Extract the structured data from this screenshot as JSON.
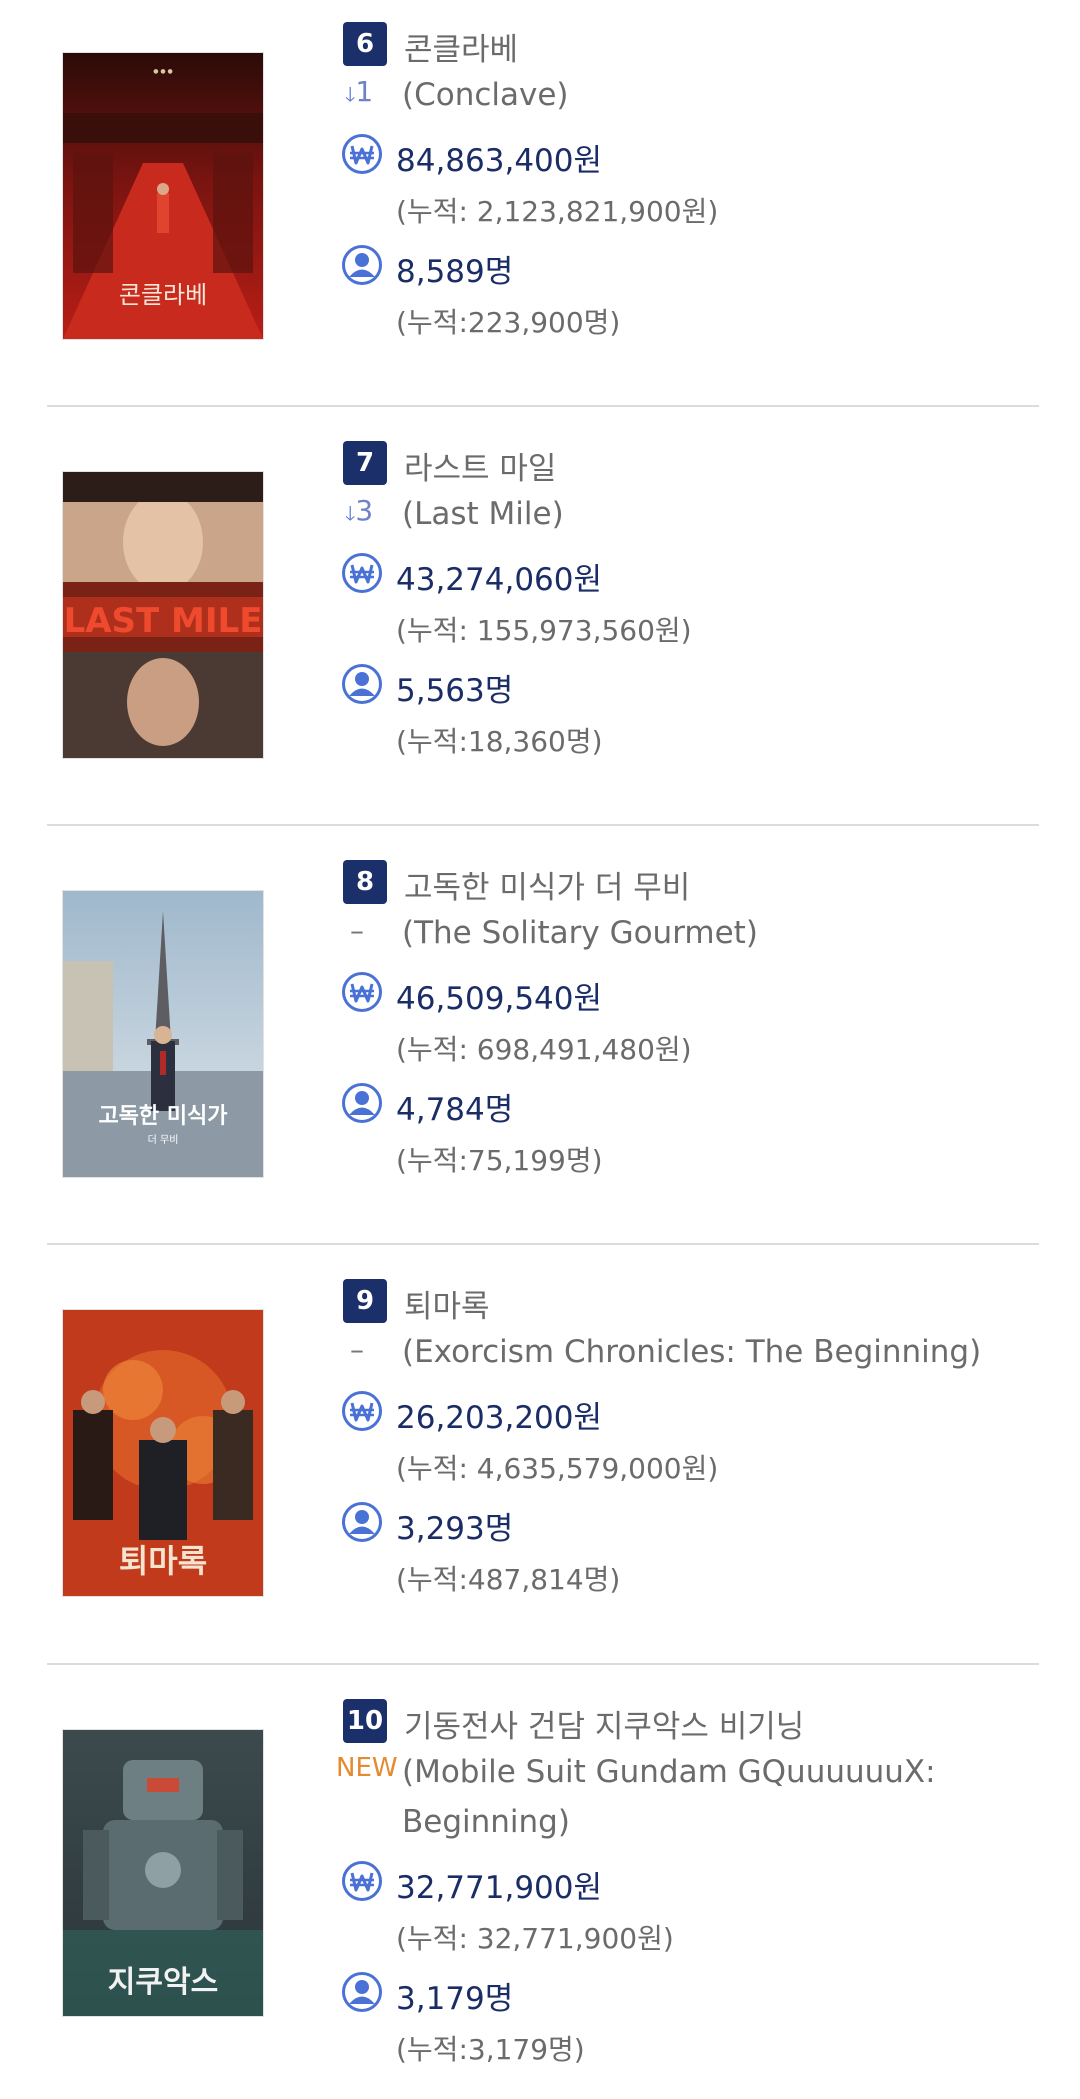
{
  "movies": [
    {
      "rank": "6",
      "title_ko": "콘클라베",
      "change_icon": "arrow-down",
      "change": "1",
      "title_en": "(Conclave)",
      "revenue": "84,863,400원",
      "revenue_total": "(누적: 2,123,821,900원)",
      "audience": "8,589명",
      "audience_total": "(누적:223,900명)",
      "poster_text": "콘클라베"
    },
    {
      "rank": "7",
      "title_ko": "라스트 마일",
      "change_icon": "arrow-down",
      "change": "3",
      "title_en": "(Last Mile)",
      "revenue": "43,274,060원",
      "revenue_total": "(누적: 155,973,560원)",
      "audience": "5,563명",
      "audience_total": "(누적:18,360명)",
      "poster_text": "LAST MILE"
    },
    {
      "rank": "8",
      "title_ko": "고독한 미식가 더 무비",
      "change": "–",
      "title_en": "(The Solitary Gourmet)",
      "revenue": "46,509,540원",
      "revenue_total": "(누적: 698,491,480원)",
      "audience": "4,784명",
      "audience_total": "(누적:75,199명)",
      "poster_text": "고독한 미식가"
    },
    {
      "rank": "9",
      "title_ko": "퇴마록",
      "change": "–",
      "title_en": "(Exorcism Chronicles: The Beginning)",
      "revenue": "26,203,200원",
      "revenue_total": "(누적: 4,635,579,000원)",
      "audience": "3,293명",
      "audience_total": "(누적:487,814명)",
      "poster_text": "퇴마록"
    },
    {
      "rank": "10",
      "title_ko": "기동전사 건담 지쿠악스 비기닝",
      "change": "NEW",
      "title_en": "(Mobile Suit Gundam GQuuuuuuX: Beginning)",
      "revenue": "32,771,900원",
      "revenue_total": "(누적: 32,771,900원)",
      "audience": "3,179명",
      "audience_total": "(누적:3,179명)",
      "poster_text": "지쿠악스"
    }
  ],
  "icons": {
    "revenue": "won-icon",
    "audience": "person-icon"
  },
  "colors": {
    "rank_badge": "#1b2f6b",
    "stat_text": "#1b2d66",
    "icon_blue": "#4a72d6",
    "new_badge": "#e58a2e"
  }
}
